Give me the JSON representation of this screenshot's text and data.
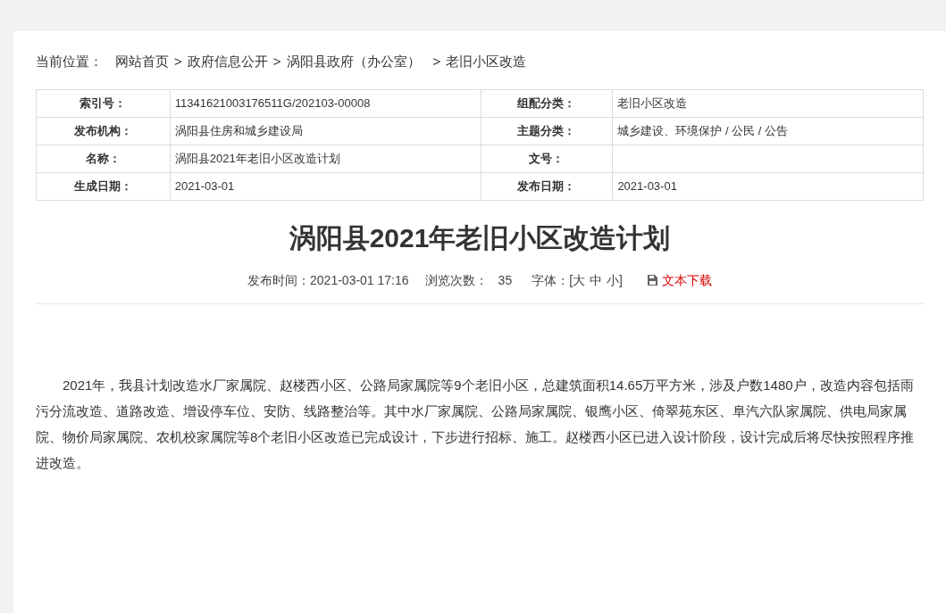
{
  "breadcrumb": {
    "label": "当前位置：",
    "items": [
      {
        "label": "网站首页"
      },
      {
        "prefix": ">",
        "label": "政府信息公开"
      },
      {
        "prefix": ">",
        "label": "涡阳县政府（办公室）"
      },
      {
        "prefix": ">",
        "label": "老旧小区改造"
      }
    ]
  },
  "info_table": {
    "rows": [
      [
        {
          "label": "索引号：",
          "value": "11341621003176511G/202103-00008"
        },
        {
          "label": "组配分类：",
          "value": "老旧小区改造"
        }
      ],
      [
        {
          "label": "发布机构：",
          "value": "涡阳县住房和城乡建设局"
        },
        {
          "label": "主题分类：",
          "value": "城乡建设、环境保护 / 公民 / 公告"
        }
      ],
      [
        {
          "label": "名称：",
          "value": "涡阳县2021年老旧小区改造计划"
        },
        {
          "label": "文号："
        }
      ],
      [
        {
          "label": "生成日期：",
          "value": "2021-03-01"
        },
        {
          "label": "发布日期：",
          "value": "2021-03-01"
        }
      ]
    ]
  },
  "article": {
    "title": "涡阳县2021年老旧小区改造计划",
    "meta": {
      "publish_time": "发布时间：2021-03-01 17:16",
      "views_label": "浏览次数：",
      "views": "35",
      "font_label": "字体：",
      "bracket_open": "[",
      "font_sizes": [
        "大",
        "中",
        "小"
      ],
      "bracket_close": "]",
      "download": "文本下载"
    },
    "body": "2021年，我县计划改造水厂家属院、赵楼西小区、公路局家属院等9个老旧小区，总建筑面积14.65万平方米，涉及户数1480户，改造内容包括雨污分流改造、道路改造、增设停车位、安防、线路整治等。其中水厂家属院、公路局家属院、银鹰小区、倚翠苑东区、阜汽六队家属院、供电局家属院、物价局家属院、农机校家属院等8个老旧小区改造已完成设计，下步进行招标、施工。赵楼西小区已进入设计阶段，设计完成后将尽快按照程序推进改造。"
  }
}
